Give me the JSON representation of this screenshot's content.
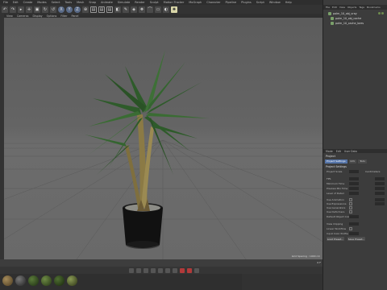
{
  "menubar": {
    "items": [
      "File",
      "Edit",
      "Create",
      "Modes",
      "Select",
      "Tools",
      "Mesh",
      "Snap",
      "Animate",
      "Simulate",
      "Render",
      "Sculpt",
      "Motion Tracker",
      "MoGraph",
      "Character",
      "Pipeline",
      "Plugins",
      "Script",
      "Window",
      "Help"
    ]
  },
  "viewport": {
    "menu": [
      "View",
      "Cameras",
      "Display",
      "Options",
      "Filter",
      "Panel"
    ],
    "grid_label": "Grid Spacing : 1000 cm"
  },
  "object_manager": {
    "tabs": [
      "File",
      "Edit",
      "View",
      "Objects",
      "Tags",
      "Bookmarks"
    ],
    "objects": [
      "palm_10_obj_vray",
      "palm_10_obj_cache",
      "palm_10_cache_lores"
    ]
  },
  "attributes": {
    "tabs": [
      "Mode",
      "Edit",
      "User Data"
    ],
    "title": "Project",
    "subtabs": [
      "Project Settings",
      "Info",
      "Todo"
    ],
    "section": "Project Settings",
    "rows": [
      {
        "label": "Project Scale",
        "extra": "Centimeters"
      },
      {
        "label": "FPS"
      },
      {
        "label": "Minimum Time"
      },
      {
        "label": "Preview Min Time"
      },
      {
        "label": "Level of Detail"
      },
      {
        "label": "Use Animation"
      },
      {
        "label": "Use Expressions"
      },
      {
        "label": "Use Generators"
      },
      {
        "label": "Use Deformers"
      },
      {
        "label": "Default Object Color"
      },
      {
        "label": "View Clipping"
      },
      {
        "label": "Linear Workflow"
      },
      {
        "label": "Input Color Profile"
      }
    ],
    "buttons": [
      "Load Preset...",
      "Save Preset..."
    ]
  },
  "timeline": {
    "frame": "0 F"
  }
}
